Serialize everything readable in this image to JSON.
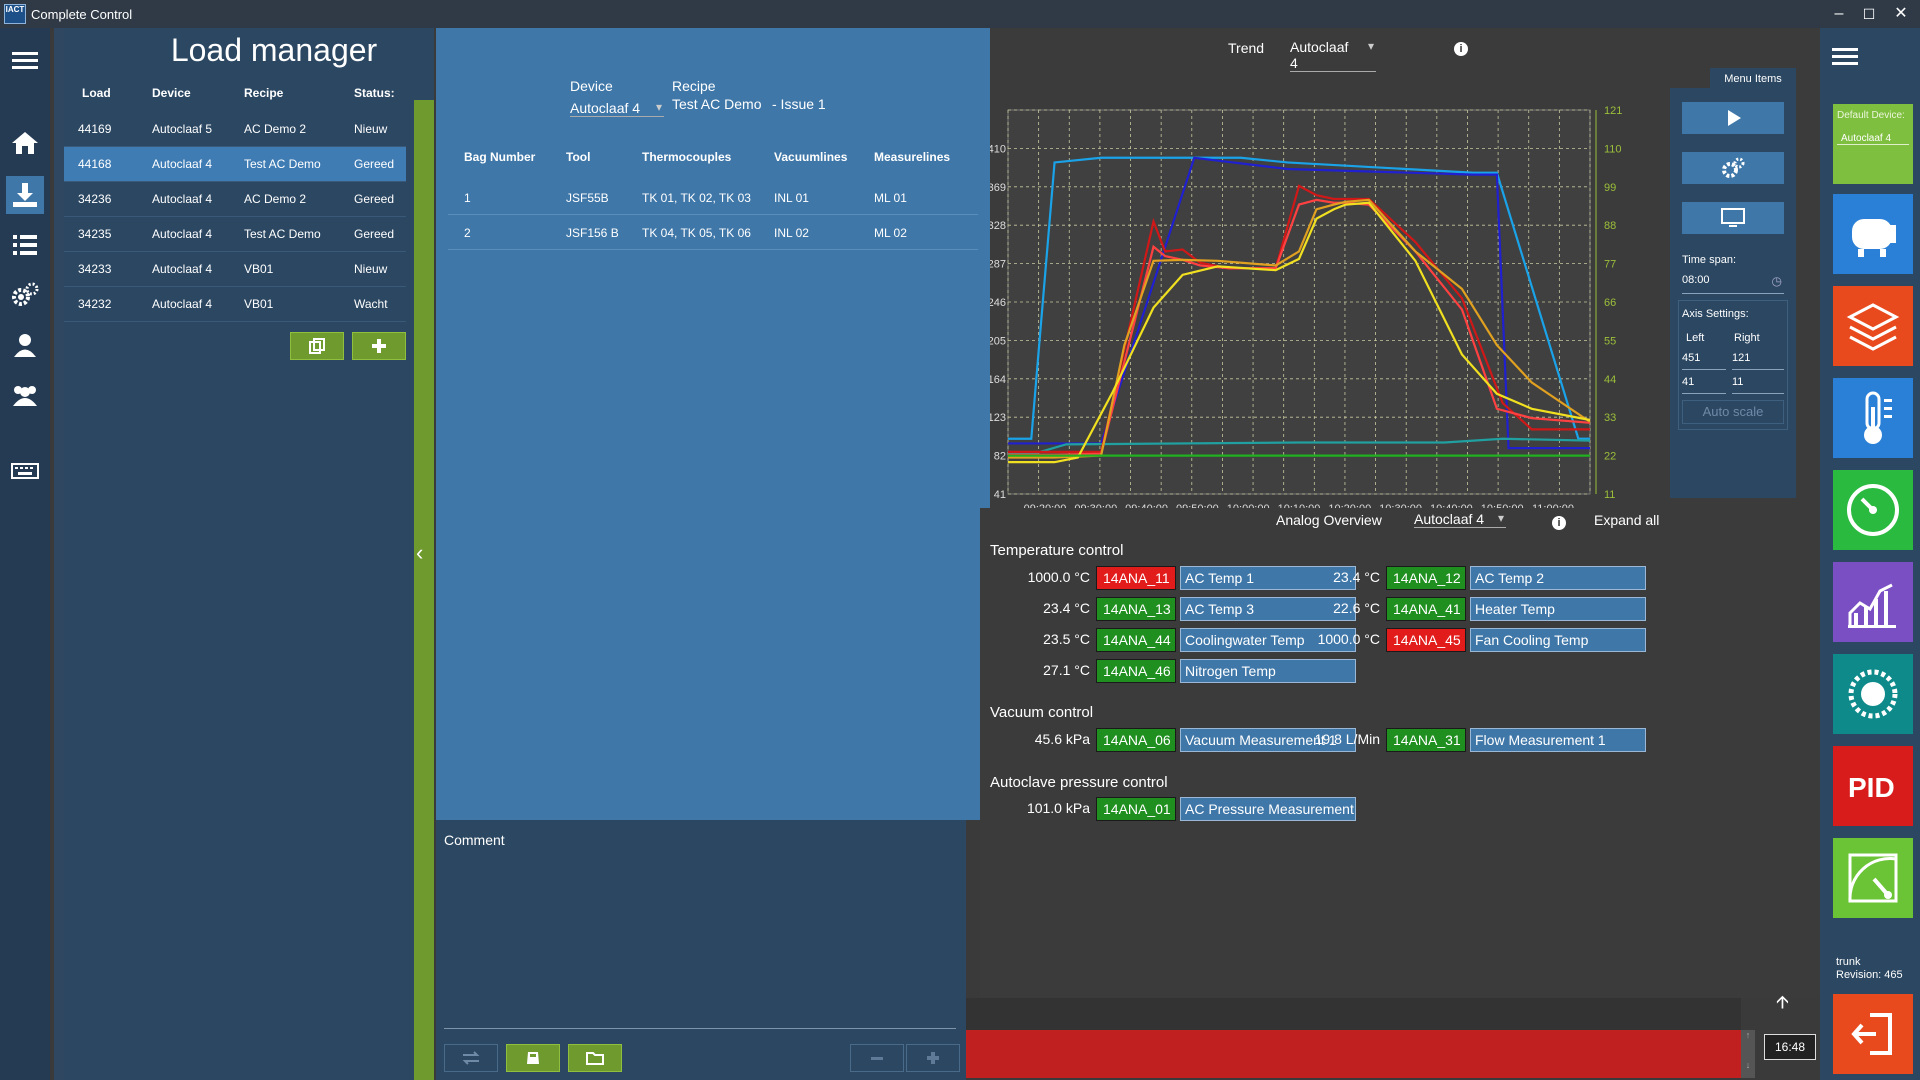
{
  "window": {
    "title": "Complete Control",
    "logo_text": "IACT"
  },
  "load_manager": {
    "title": "Load manager",
    "columns": [
      "Load",
      "Device",
      "Recipe",
      "Status:"
    ],
    "rows": [
      {
        "load": "44169",
        "device": "Autoclaaf 5",
        "recipe": "AC Demo 2",
        "status": "Nieuw"
      },
      {
        "load": "44168",
        "device": "Autoclaaf 4",
        "recipe": "Test AC Demo",
        "status": "Gereed"
      },
      {
        "load": "34236",
        "device": "Autoclaaf 4",
        "recipe": "AC Demo 2",
        "status": "Gereed"
      },
      {
        "load": "34235",
        "device": "Autoclaaf 4",
        "recipe": "Test AC Demo",
        "status": "Gereed"
      },
      {
        "load": "34233",
        "device": "Autoclaaf 4",
        "recipe": "VB01",
        "status": "Nieuw"
      },
      {
        "load": "34232",
        "device": "Autoclaaf 4",
        "recipe": "VB01",
        "status": "Wacht"
      }
    ]
  },
  "recipe": {
    "device_label": "Device",
    "device_value": "Autoclaaf 4",
    "recipe_label": "Recipe",
    "recipe_value": "Test AC Demo",
    "issue": "- Issue 1",
    "columns": [
      "Bag Number",
      "Tool",
      "Thermocouples",
      "Vacuumlines",
      "Measurelines"
    ],
    "rows": [
      {
        "bag": "1",
        "tool": "JSF55B",
        "tc": "TK 01, TK 02, TK 03",
        "vac": "INL 01",
        "ml": "ML 01"
      },
      {
        "bag": "2",
        "tool": "JSF156 B",
        "tc": "TK 04, TK 05, TK 06",
        "vac": "INL 02",
        "ml": "ML 02"
      }
    ],
    "comment_label": "Comment"
  },
  "trend": {
    "label": "Trend",
    "device": "Autoclaaf 4"
  },
  "chart_data": {
    "type": "line",
    "x_ticks": [
      "09:20:00",
      "09:30:00",
      "09:40:00",
      "09:50:00",
      "10:00:00",
      "10:10:00",
      "10:20:00",
      "10:30:00",
      "10:40:00",
      "10:50:00",
      "11:00:00"
    ],
    "left_ticks": [
      "41",
      "82",
      "123",
      "164",
      "205",
      "246",
      "287",
      "328",
      "369",
      "410"
    ],
    "right_ticks": [
      "11",
      "22",
      "33",
      "44",
      "55",
      "66",
      "77",
      "88",
      "99",
      "110",
      "121"
    ],
    "ylim_left": [
      41,
      451
    ],
    "ylim_right": [
      11,
      121
    ],
    "grid": true,
    "series": [
      {
        "color": "#1aa3e8",
        "axis": "left",
        "x": [
          0,
          2,
          4,
          8,
          16,
          40,
          48,
          80,
          84,
          98,
          100
        ],
        "y": [
          100,
          100,
          100,
          395,
          400,
          400,
          395,
          384,
          384,
          100,
          100
        ]
      },
      {
        "color": "#2020d0",
        "axis": "left",
        "x": [
          0,
          8,
          16,
          32,
          48,
          80,
          84,
          86,
          100
        ],
        "y": [
          95,
          95,
          95,
          400,
          388,
          382,
          382,
          90,
          90
        ]
      },
      {
        "color": "#20a0a0",
        "axis": "left",
        "x": [
          0,
          5,
          10,
          50,
          75,
          85,
          100
        ],
        "y": [
          85,
          85,
          94,
          96,
          96,
          100,
          98
        ]
      },
      {
        "color": "#d01818",
        "axis": "left",
        "x": [
          0,
          8,
          16,
          25,
          27,
          30,
          33,
          38,
          46,
          50,
          53,
          56,
          58,
          62,
          70,
          78,
          85,
          90,
          100
        ],
        "y": [
          86,
          86,
          86,
          332,
          300,
          302,
          288,
          282,
          282,
          370,
          360,
          356,
          356,
          356,
          310,
          250,
          138,
          110,
          110
        ]
      },
      {
        "color": "#ff4040",
        "axis": "left",
        "x": [
          0,
          8,
          16,
          25,
          27,
          30,
          33,
          38,
          46,
          50,
          53,
          56,
          58,
          62,
          70,
          78,
          84,
          90,
          100
        ],
        "y": [
          83,
          83,
          84,
          305,
          295,
          291,
          285,
          282,
          282,
          350,
          355,
          352,
          352,
          350,
          300,
          238,
          132,
          122,
          117
        ]
      },
      {
        "color": "#e0a020",
        "axis": "left",
        "x": [
          0,
          8,
          16,
          20,
          25,
          30,
          36,
          46,
          50,
          53,
          56,
          58,
          62,
          70,
          78,
          84,
          90,
          100
        ],
        "y": [
          80,
          80,
          82,
          200,
          290,
          291,
          290,
          285,
          300,
          345,
          350,
          353,
          355,
          300,
          260,
          200,
          160,
          118
        ]
      },
      {
        "color": "#f0e020",
        "axis": "left",
        "x": [
          0,
          8,
          12,
          18,
          25,
          30,
          36,
          46,
          50,
          53,
          56,
          58,
          62,
          70,
          78,
          84,
          90,
          100
        ],
        "y": [
          75,
          75,
          80,
          150,
          240,
          275,
          284,
          280,
          292,
          335,
          345,
          350,
          352,
          290,
          190,
          148,
          132,
          120
        ]
      },
      {
        "color": "#20b020",
        "axis": "left",
        "x": [
          0,
          100
        ],
        "y": [
          82,
          82
        ]
      }
    ]
  },
  "menu": {
    "title": "Menu Items",
    "time_span_label": "Time span:",
    "time_span_value": "08:00",
    "axis_settings_label": "Axis Settings:",
    "left_label": "Left",
    "right_label": "Right",
    "left_max": "451",
    "right_max": "121",
    "left_min": "41",
    "right_min": "11",
    "auto_scale": "Auto scale"
  },
  "analog": {
    "label": "Analog Overview",
    "device": "Autoclaaf 4",
    "expand_all": "Expand all",
    "temp_title": "Temperature control",
    "vac_title": "Vacuum control",
    "pressure_title": "Autoclave pressure control",
    "temp": [
      {
        "value": "1000.0 °C",
        "tag": "14ANA_11",
        "status": "r",
        "desc": "AC Temp 1"
      },
      {
        "value": "23.4 °C",
        "tag": "14ANA_12",
        "status": "g",
        "desc": "AC Temp 2"
      },
      {
        "value": "23.4 °C",
        "tag": "14ANA_13",
        "status": "g",
        "desc": "AC Temp 3"
      },
      {
        "value": "22.6 °C",
        "tag": "14ANA_41",
        "status": "g",
        "desc": "Heater Temp"
      },
      {
        "value": "23.5 °C",
        "tag": "14ANA_44",
        "status": "g",
        "desc": "Coolingwater Temp"
      },
      {
        "value": "1000.0 °C",
        "tag": "14ANA_45",
        "status": "r",
        "desc": "Fan Cooling Temp"
      },
      {
        "value": "27.1 °C",
        "tag": "14ANA_46",
        "status": "g",
        "desc": "Nitrogen Temp"
      }
    ],
    "vac": [
      {
        "value": "45.6 kPa",
        "tag": "14ANA_06",
        "status": "g",
        "desc": "Vacuum Measurement 1"
      },
      {
        "value": "19.8 L/Min",
        "tag": "14ANA_31",
        "status": "g",
        "desc": "Flow Measurement 1"
      }
    ],
    "pressure": [
      {
        "value": "101.0 kPa",
        "tag": "14ANA_01",
        "status": "g",
        "desc": "AC Pressure Measurement"
      }
    ]
  },
  "right_nav": {
    "default_device_label": "Default Device:",
    "default_device_value": "Autoclaaf 4",
    "revision_branch": "trunk",
    "revision": "Revision: 465"
  },
  "status": {
    "clock": "16:48"
  },
  "colors": {
    "accent": "#3f77a8",
    "green": "#6f9a2e",
    "alarm": "#e21b1b",
    "ok": "#1f8f1f"
  }
}
